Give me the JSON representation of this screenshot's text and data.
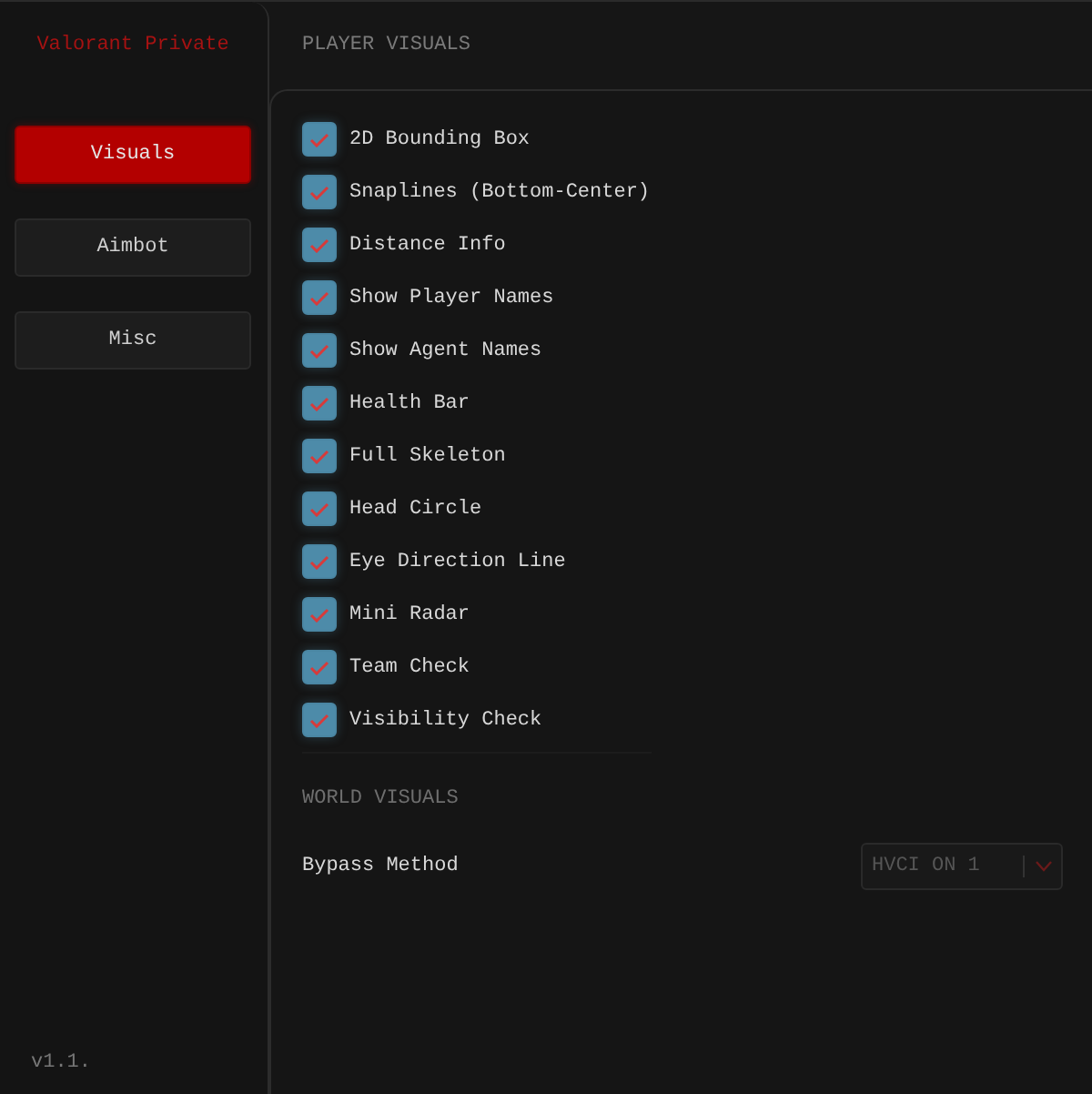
{
  "sidebar": {
    "title": "Valorant Private",
    "items": [
      {
        "label": "Visuals",
        "selected": true
      },
      {
        "label": "Aimbot",
        "selected": false
      },
      {
        "label": "Misc",
        "selected": false
      }
    ],
    "version": "v1.1."
  },
  "page_heading": "PLAYER VISUALS",
  "options": [
    {
      "label": "2D Bounding Box",
      "checked": true
    },
    {
      "label": "Snaplines (Bottom-Center)",
      "checked": true
    },
    {
      "label": "Distance Info",
      "checked": true
    },
    {
      "label": "Show Player Names",
      "checked": true
    },
    {
      "label": "Show Agent Names",
      "checked": true
    },
    {
      "label": "Health Bar",
      "checked": true
    },
    {
      "label": "Full Skeleton",
      "checked": true
    },
    {
      "label": "Head Circle",
      "checked": true
    },
    {
      "label": "Eye Direction Line",
      "checked": true
    },
    {
      "label": "Mini Radar",
      "checked": true
    },
    {
      "label": "Team Check",
      "checked": true
    },
    {
      "label": "Visibility Check",
      "checked": true
    }
  ],
  "world_heading": "WORLD VISUALS",
  "bypass": {
    "label": "Bypass Method",
    "value": "HVCI ON 1",
    "disabled": true
  }
}
